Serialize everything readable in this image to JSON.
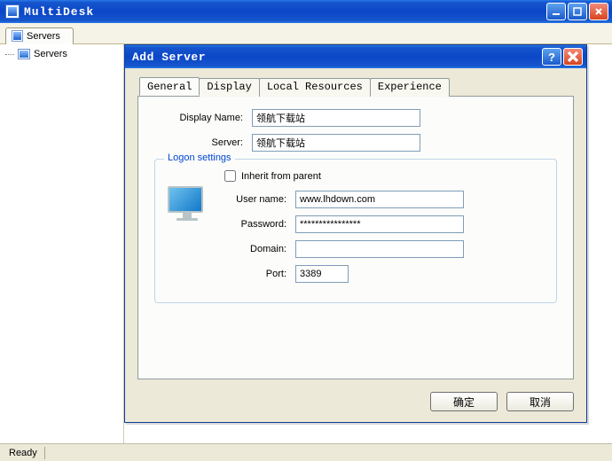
{
  "app": {
    "title": "MultiDesk"
  },
  "main_tabs": {
    "servers": "Servers"
  },
  "sidebar": {
    "root_label": "Servers"
  },
  "statusbar": {
    "text": "Ready"
  },
  "dialog": {
    "title": "Add Server",
    "tabs": {
      "general": "General",
      "display": "Display",
      "local_resources": "Local Resources",
      "experience": "Experience"
    },
    "fields": {
      "display_name_label": "Display Name:",
      "display_name_value": "领航下载站",
      "server_label": "Server:",
      "server_value": "领航下载站",
      "logon_legend": "Logon settings",
      "inherit_label": "Inherit from parent",
      "inherit_checked": false,
      "username_label": "User name:",
      "username_value": "www.lhdown.com",
      "password_label": "Password:",
      "password_value": "****************",
      "domain_label": "Domain:",
      "domain_value": "",
      "port_label": "Port:",
      "port_value": "3389"
    },
    "buttons": {
      "ok": "确定",
      "cancel": "取消"
    }
  }
}
